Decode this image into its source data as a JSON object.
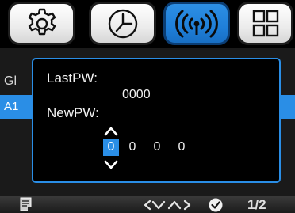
{
  "tabs": [
    {
      "icon": "gear-icon",
      "active": false
    },
    {
      "icon": "clock-icon",
      "active": false
    },
    {
      "icon": "wireless-signal-icon",
      "active": true
    },
    {
      "icon": "grid-icon",
      "active": false
    }
  ],
  "background_menu": {
    "row1_label": "Gl",
    "row2_label": "A1"
  },
  "dialog": {
    "last_pw_label": "LastPW:",
    "last_pw_value": "0000",
    "new_pw_label": "NewPW:",
    "new_pw_digits": [
      "0",
      "0",
      "0",
      "0"
    ],
    "selected_digit_index": 0
  },
  "bottom_bar": {
    "page_indicator": "1/2"
  },
  "colors": {
    "accent": "#2a8ee6",
    "tab_active": "#1f7fd9",
    "background": "#000000"
  }
}
